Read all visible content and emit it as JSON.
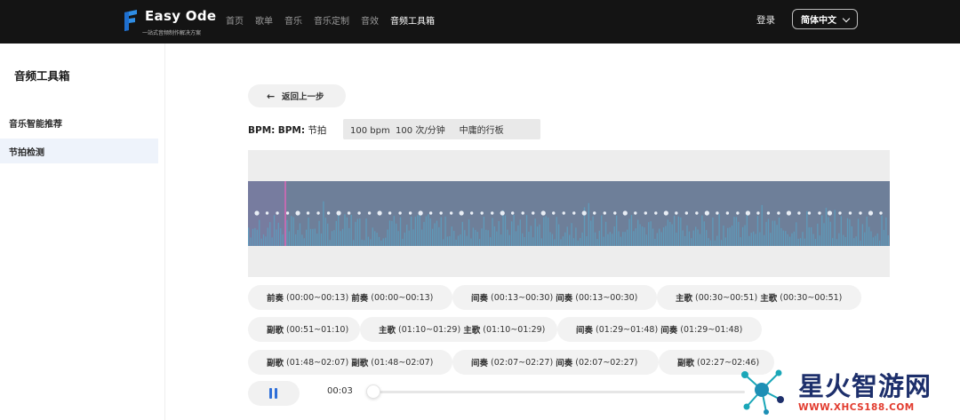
{
  "header": {
    "logo_text": "Easy Ode",
    "logo_subtitle": "一站式音频制作解决方案",
    "nav": [
      {
        "label": "首页",
        "active": false
      },
      {
        "label": "歌单",
        "active": false
      },
      {
        "label": "音乐",
        "active": false
      },
      {
        "label": "音乐定制",
        "active": false
      },
      {
        "label": "音效",
        "active": false
      },
      {
        "label": "音频工具箱",
        "active": true
      }
    ],
    "login_label": "登录",
    "language_label": "简体中文"
  },
  "sidebar": {
    "title": "音频工具箱",
    "items": [
      {
        "label": "音乐智能推荐",
        "active": false
      },
      {
        "label": "节拍检测",
        "active": true
      }
    ]
  },
  "main": {
    "back_label": "返回上一步",
    "bpm_label": "BPM:",
    "bpm_label2": "BPM:",
    "bpm_label3": "节拍",
    "bpm_value": "100 bpm  100 次/分钟     中庸的行板",
    "segments": [
      {
        "name": "前奏",
        "range": "(00:00~00:13)",
        "name2": "前奏",
        "range2": "(00:00~00:13)"
      },
      {
        "name": "间奏",
        "range": "(00:13~00:30)",
        "name2": "间奏",
        "range2": "(00:13~00:30)"
      },
      {
        "name": "主歌",
        "range": "(00:30~00:51)",
        "name2": "主歌",
        "range2": "(00:30~00:51)"
      },
      {
        "name": "副歌",
        "range": "(00:51~01:10)",
        "name2": "",
        "range2": ""
      },
      {
        "name": "主歌",
        "range": "(01:10~01:29)",
        "name2": "主歌",
        "range2": "(01:10~01:29)"
      },
      {
        "name": "间奏",
        "range": "(01:29~01:48)",
        "name2": "间奏",
        "range2": "(01:29~01:48)"
      },
      {
        "name": "副歌",
        "range": "(01:48~02:07)",
        "name2": "副歌",
        "range2": "(01:48~02:07)"
      },
      {
        "name": "间奏",
        "range": "(02:07~02:27)",
        "name2": "间奏",
        "range2": "(02:07~02:27)"
      },
      {
        "name": "副歌",
        "range": "(02:27~02:46)",
        "name2": "",
        "range2": ""
      }
    ],
    "player": {
      "state_icon": "pause-icon",
      "current_time": "00:03",
      "progress": 0.0
    }
  },
  "waveform": {
    "beat_dot_count": 62,
    "bar_count": 300,
    "colors": {
      "panel": "#6e7f99",
      "bars": "#5c9fbf",
      "dots": "#e9eef5",
      "playhead": "#c16cb0",
      "played": "#7d7aa3"
    }
  },
  "watermark": {
    "cn": "星火智游网",
    "en": "WWW.XHCS188.COM"
  },
  "colors": {
    "accent": "#2f6fd8",
    "topbar": "#141414"
  }
}
